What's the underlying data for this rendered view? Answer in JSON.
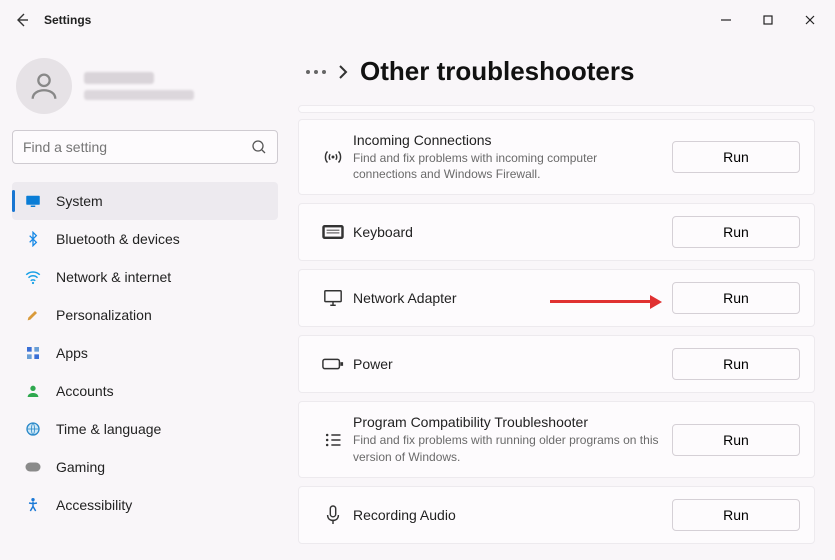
{
  "window": {
    "title": "Settings"
  },
  "search": {
    "placeholder": "Find a setting"
  },
  "nav": [
    {
      "label": "System",
      "active": true,
      "icon": "monitor"
    },
    {
      "label": "Bluetooth & devices",
      "icon": "bluetooth"
    },
    {
      "label": "Network & internet",
      "icon": "wifi"
    },
    {
      "label": "Personalization",
      "icon": "brush"
    },
    {
      "label": "Apps",
      "icon": "apps"
    },
    {
      "label": "Accounts",
      "icon": "person"
    },
    {
      "label": "Time & language",
      "icon": "globe"
    },
    {
      "label": "Gaming",
      "icon": "gamepad"
    },
    {
      "label": "Accessibility",
      "icon": "accessibility"
    }
  ],
  "page": {
    "title": "Other troubleshooters"
  },
  "items": [
    {
      "title": "Incoming Connections",
      "desc": "Find and fix problems with incoming computer connections and Windows Firewall.",
      "icon": "broadcast",
      "run": "Run"
    },
    {
      "title": "Keyboard",
      "desc": "",
      "icon": "keyboard",
      "run": "Run"
    },
    {
      "title": "Network Adapter",
      "desc": "",
      "icon": "display",
      "run": "Run"
    },
    {
      "title": "Power",
      "desc": "",
      "icon": "battery",
      "run": "Run"
    },
    {
      "title": "Program Compatibility Troubleshooter",
      "desc": "Find and fix problems with running older programs on this version of Windows.",
      "icon": "list",
      "run": "Run"
    },
    {
      "title": "Recording Audio",
      "desc": "",
      "icon": "mic",
      "run": "Run"
    }
  ]
}
